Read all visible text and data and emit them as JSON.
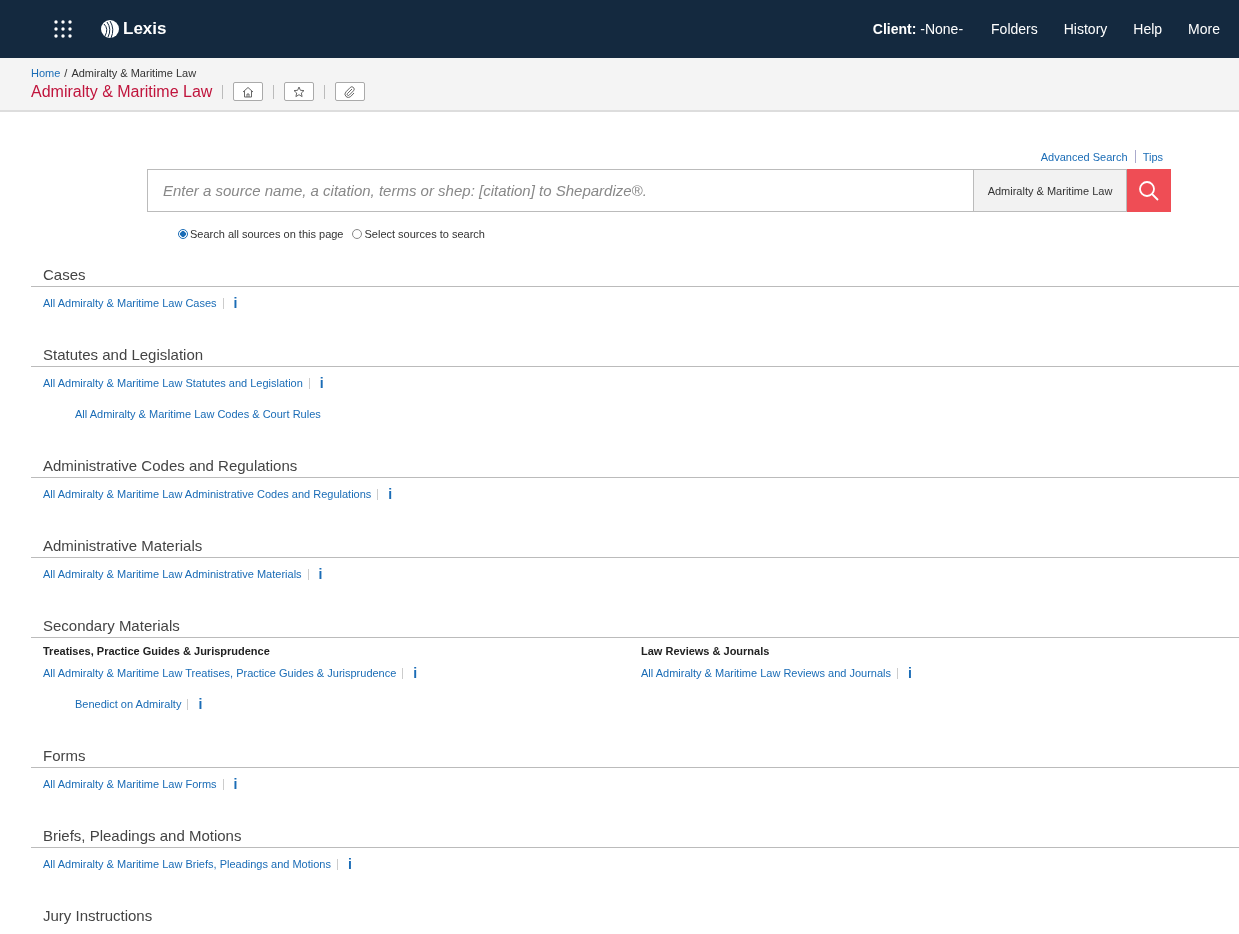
{
  "header": {
    "logo": "Lexis",
    "client_label": "Client:",
    "client_value": "-None-",
    "nav": [
      "Folders",
      "History",
      "Help",
      "More"
    ]
  },
  "breadcrumb": {
    "home": "Home",
    "separator": "/",
    "current": "Admiralty & Maritime Law"
  },
  "page_title": "Admiralty & Maritime Law",
  "search": {
    "links": [
      "Advanced Search",
      "Tips"
    ],
    "placeholder": "Enter a source name, a citation, terms or shep: [citation] to Shepardize®.",
    "scope": "Admiralty & Maritime Law",
    "options": [
      {
        "label": "Search all sources on this page",
        "selected": true
      },
      {
        "label": "Select sources to search",
        "selected": false
      }
    ]
  },
  "sections": [
    {
      "title": "Cases",
      "columns": [
        {
          "links": [
            {
              "text": "All Admiralty & Maritime Law Cases",
              "info": "i"
            }
          ]
        }
      ]
    },
    {
      "title": "Statutes and Legislation",
      "columns": [
        {
          "links": [
            {
              "text": "All Admiralty & Maritime Law Statutes and Legislation",
              "info": "i",
              "children": [
                {
                  "text": "All Admiralty & Maritime Law Codes & Court Rules"
                }
              ]
            }
          ]
        }
      ]
    },
    {
      "title": "Administrative Codes and Regulations",
      "columns": [
        {
          "links": [
            {
              "text": "All Admiralty & Maritime Law Administrative Codes and Regulations",
              "info": "i"
            }
          ]
        }
      ]
    },
    {
      "title": "Administrative Materials",
      "columns": [
        {
          "links": [
            {
              "text": "All Admiralty & Maritime Law Administrative Materials",
              "info": "i"
            }
          ]
        }
      ]
    },
    {
      "title": "Secondary Materials",
      "columns": [
        {
          "heading": "Treatises, Practice Guides & Jurisprudence",
          "links": [
            {
              "text": "All Admiralty & Maritime Law Treatises, Practice Guides & Jurisprudence",
              "info": "i",
              "children": [
                {
                  "text": "Benedict on Admiralty",
                  "info": "i"
                }
              ]
            }
          ]
        },
        {
          "heading": "Law Reviews & Journals",
          "links": [
            {
              "text": "All Admiralty & Maritime Law Reviews and Journals",
              "info": "i"
            }
          ]
        }
      ]
    },
    {
      "title": "Forms",
      "columns": [
        {
          "links": [
            {
              "text": "All Admiralty & Maritime Law Forms",
              "info": "i"
            }
          ]
        }
      ]
    },
    {
      "title": "Briefs, Pleadings and Motions",
      "columns": [
        {
          "links": [
            {
              "text": "All Admiralty & Maritime Law Briefs, Pleadings and Motions",
              "info": "i"
            }
          ]
        }
      ]
    },
    {
      "title": "Jury Instructions"
    }
  ]
}
